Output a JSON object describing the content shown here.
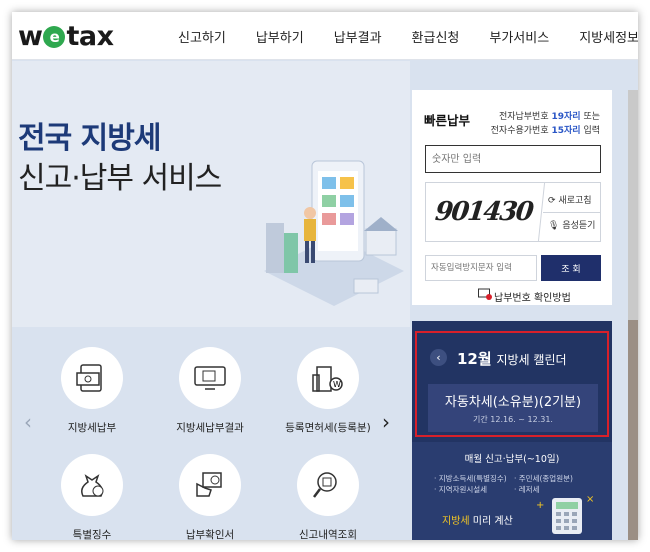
{
  "header": {
    "logo": {
      "pre": "w",
      "e": "e",
      "post": "tax"
    },
    "nav": [
      "신고하기",
      "납부하기",
      "납부결과",
      "환급신청",
      "부가서비스",
      "지방세정보"
    ]
  },
  "hero": {
    "title_line1": "전국 지방세",
    "title_line2": "신고·납부 서비스"
  },
  "quick_pay": {
    "title": "빠른납부",
    "info_line1_pre": "전자납부번호 ",
    "info_line1_hl": "19자리",
    "info_line1_post": " 또는",
    "info_line2_pre": "전자수용가번호 ",
    "info_line2_hl": "15자리",
    "info_line2_post": " 입력",
    "number_placeholder": "숫자만 입력",
    "captcha_text": "901430",
    "refresh_label": "새로고침",
    "audio_label": "음성듣기",
    "code_placeholder": "자동입력방지문자 입력",
    "lookup_label": "조 회",
    "how_to_label": "납부번호 확인방법"
  },
  "menu": {
    "items": [
      {
        "label": "지방세납부",
        "icon": "payment-screen-icon"
      },
      {
        "label": "지방세납부결과",
        "icon": "monitor-documents-icon"
      },
      {
        "label": "등록면허세(등록분)",
        "icon": "building-coin-icon"
      },
      {
        "label": "특별징수",
        "icon": "money-bag-icon"
      },
      {
        "label": "납부확인서",
        "icon": "receipt-hand-icon"
      },
      {
        "label": "신고내역조회",
        "icon": "magnifier-document-icon"
      }
    ]
  },
  "calendar": {
    "month": "12월",
    "title": "지방세 캘린더",
    "card_title": "자동차세(소유분)(2기분)",
    "card_period": "기간 12.16. ~ 12.31.",
    "sub_title": "매월 신고·납부(~10일)",
    "list_a": [
      "· 지방소득세(특별징수)",
      "· 지역자원시설세"
    ],
    "list_b": [
      "· 주민세(종업원분)",
      "· 레저세"
    ],
    "calc_highlight": "지방세",
    "calc_rest": " 미리 계산"
  },
  "colors": {
    "brand_navy": "#1d3a78",
    "calendar_bg": "#223463",
    "logo_green": "#2fa84f",
    "highlight_red": "#d8202a",
    "accent_blue": "#2a56c6"
  }
}
